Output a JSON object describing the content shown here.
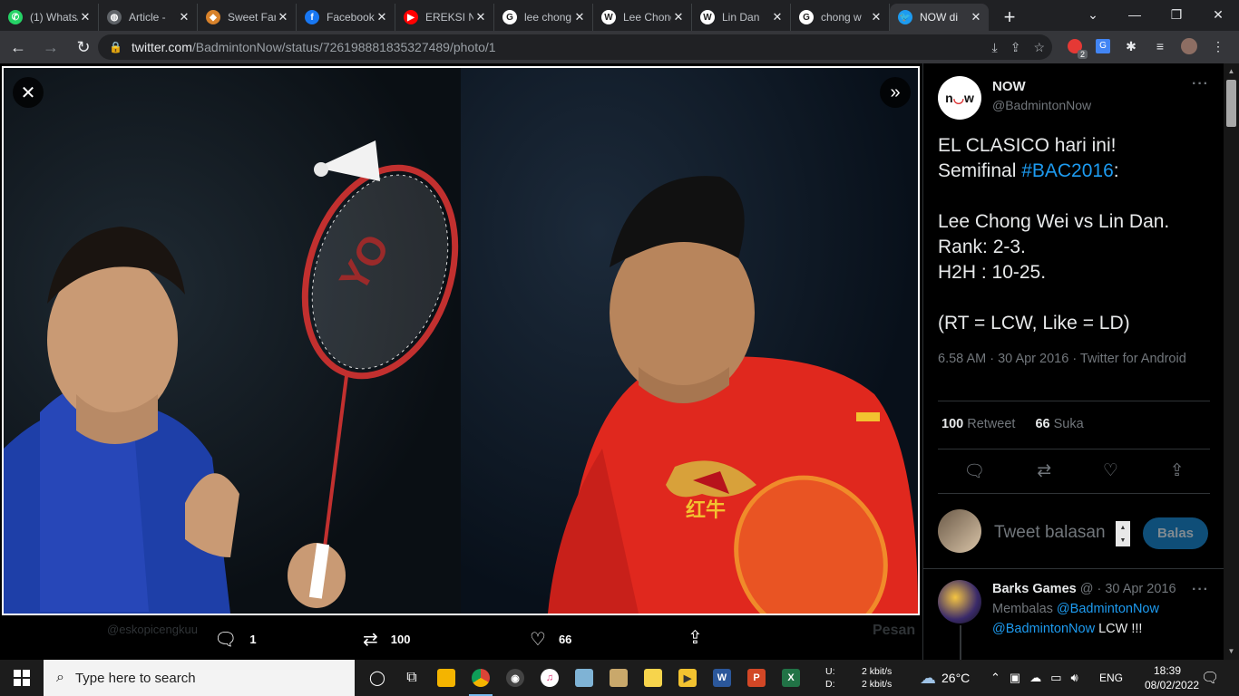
{
  "browser": {
    "tabs": [
      {
        "title": "(1) WhatsApp",
        "favicon": "whatsapp-icon",
        "color": "#25d366",
        "glyph": "✆"
      },
      {
        "title": "Article -",
        "favicon": "globe-icon",
        "color": "#5f6368",
        "glyph": "◍"
      },
      {
        "title": "Sweet Fanny",
        "favicon": "site-icon",
        "color": "#d8822b",
        "glyph": "◆"
      },
      {
        "title": "Facebook",
        "favicon": "facebook-icon",
        "color": "#1877f2",
        "glyph": "f"
      },
      {
        "title": "EREKSI N",
        "favicon": "youtube-icon",
        "color": "#ff0000",
        "glyph": "▶"
      },
      {
        "title": "lee chong",
        "favicon": "google-icon",
        "color": "#ffffff",
        "glyph": "G"
      },
      {
        "title": "Lee Chong",
        "favicon": "wikipedia-icon",
        "color": "#ffffff",
        "glyph": "W"
      },
      {
        "title": "Lin Dan",
        "favicon": "wikipedia-icon",
        "color": "#ffffff",
        "glyph": "W"
      },
      {
        "title": "chong w",
        "favicon": "google-icon",
        "color": "#ffffff",
        "glyph": "G"
      },
      {
        "title": "NOW di",
        "favicon": "twitter-icon",
        "color": "#1d9bf0",
        "glyph": "🐦",
        "active": true
      }
    ],
    "url_host": "twitter.com",
    "url_path": "/BadmintonNow/status/726198881835327489/photo/1",
    "extension_badge": "2"
  },
  "photo_view": {
    "reply_count": "1",
    "retweet_count": "100",
    "like_count": "66",
    "ghost_handle": "@eskopicengkuu",
    "ghost_label": "Pesan"
  },
  "tweet": {
    "author_name": "NOW",
    "author_handle": "@BadmintonNow",
    "text_line1": "EL CLASICO hari ini!",
    "text_line2_prefix": "Semifinal ",
    "hashtag": "#BAC2016",
    "text_line2_suffix": ":",
    "text_line3": "Lee Chong Wei vs Lin Dan.",
    "text_line4": "Rank: 2-3.",
    "text_line5": "H2H : 10-25.",
    "text_line6": "(RT = LCW, Like = LD)",
    "meta": "6.58 AM · 30 Apr 2016 · Twitter for Android",
    "retweets": "100",
    "retweets_label": "Retweet",
    "likes": "66",
    "likes_label": "Suka",
    "reply_placeholder": "Tweet balasan",
    "reply_button": "Balas"
  },
  "reply": {
    "name": "Barks Games",
    "handle_date": "@ · 30 Apr 2016",
    "replying_label": "Membalas",
    "replying_to": "@BadmintonNow",
    "mention": "@BadmintonNow",
    "body": " LCW !!!"
  },
  "taskbar": {
    "search_placeholder": "Type here to search",
    "net_up_label": "U:",
    "net_down_label": "D:",
    "net_up": "2 kbit/s",
    "net_down": "2 kbit/s",
    "temperature": "26°C",
    "language": "ENG",
    "time": "18:39",
    "date": "08/02/2022"
  }
}
